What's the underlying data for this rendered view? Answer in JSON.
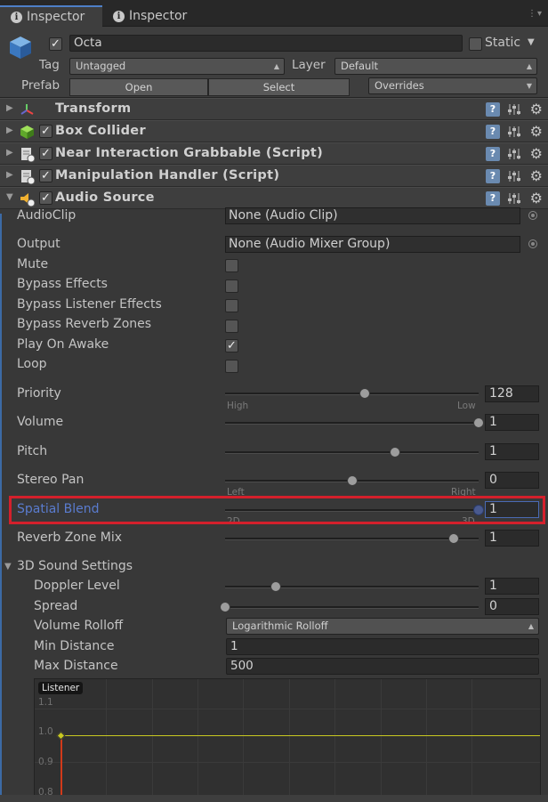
{
  "tabs": [
    {
      "label": "Inspector",
      "icon": "info-icon"
    },
    {
      "label": "Inspector",
      "icon": "info-icon"
    }
  ],
  "header": {
    "object_name": "Octa",
    "active": true,
    "static_label": "Static",
    "static_checked": false,
    "tag_label": "Tag",
    "tag_value": "Untagged",
    "layer_label": "Layer",
    "layer_value": "Default",
    "prefab_label": "Prefab",
    "open_label": "Open",
    "select_label": "Select",
    "overrides_label": "Overrides"
  },
  "components": [
    {
      "name": "Transform",
      "icon": "transform-icon",
      "has_checkbox": false
    },
    {
      "name": "Box Collider",
      "icon": "box-collider-icon",
      "has_checkbox": true
    },
    {
      "name": "Near Interaction Grabbable (Script)",
      "icon": "script-icon",
      "has_checkbox": true
    },
    {
      "name": "Manipulation Handler (Script)",
      "icon": "script-icon",
      "has_checkbox": true
    },
    {
      "name": "Audio Source",
      "icon": "audio-source-icon",
      "has_checkbox": true,
      "expanded": true
    }
  ],
  "audio": {
    "audioclip_label": "AudioClip",
    "audioclip_value": "None (Audio Clip)",
    "output_label": "Output",
    "output_value": "None (Audio Mixer Group)",
    "mute_label": "Mute",
    "mute": false,
    "bypass_effects_label": "Bypass Effects",
    "bypass_effects": false,
    "bypass_listener_label": "Bypass Listener Effects",
    "bypass_listener": false,
    "bypass_reverb_label": "Bypass Reverb Zones",
    "bypass_reverb": false,
    "play_on_awake_label": "Play On Awake",
    "play_on_awake": true,
    "loop_label": "Loop",
    "loop": false,
    "priority_label": "Priority",
    "priority_value": "128",
    "priority_fraction": 0.55,
    "priority_high": "High",
    "priority_low": "Low",
    "volume_label": "Volume",
    "volume_value": "1",
    "volume_fraction": 1.0,
    "pitch_label": "Pitch",
    "pitch_value": "1",
    "pitch_fraction": 0.67,
    "stereo_pan_label": "Stereo Pan",
    "stereo_pan_value": "0",
    "stereo_pan_fraction": 0.5,
    "pan_left": "Left",
    "pan_right": "Right",
    "spatial_blend_label": "Spatial Blend",
    "spatial_blend_value": "1",
    "spatial_blend_fraction": 1.0,
    "blend_2d": "2D",
    "blend_3d": "3D",
    "reverb_mix_label": "Reverb Zone Mix",
    "reverb_mix_value": "1",
    "reverb_mix_fraction": 0.9
  },
  "sound3d": {
    "section_label": "3D Sound Settings",
    "doppler_label": "Doppler Level",
    "doppler_value": "1",
    "doppler_fraction": 0.2,
    "spread_label": "Spread",
    "spread_value": "0",
    "spread_fraction": 0.0,
    "rolloff_label": "Volume Rolloff",
    "rolloff_value": "Logarithmic Rolloff",
    "min_distance_label": "Min Distance",
    "min_distance_value": "1",
    "max_distance_label": "Max Distance",
    "max_distance_value": "500"
  },
  "graph": {
    "listener_label": "Listener",
    "y_labels": [
      "1.1",
      "1.0",
      "0.9",
      "0.8"
    ]
  },
  "colors": {
    "highlight": "#d4202c",
    "focus_blue": "#4a6ab4",
    "curve_yellow": "#c8c820",
    "listener_red": "#d23a1a"
  }
}
